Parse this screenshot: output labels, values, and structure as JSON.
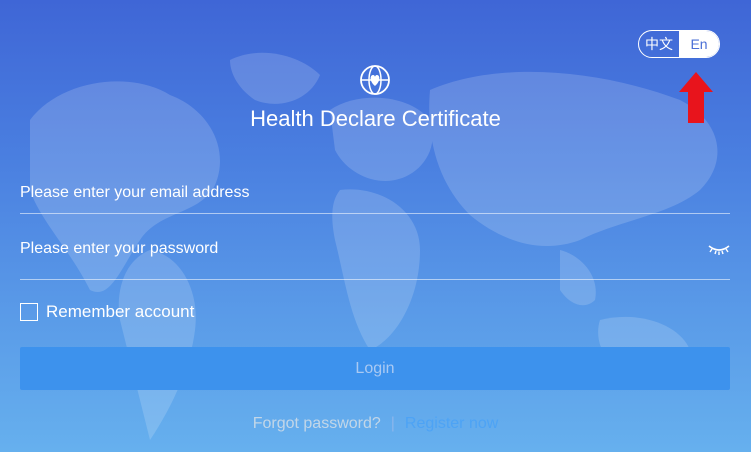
{
  "language_toggle": {
    "zh_label": "中文",
    "en_label": "En",
    "selected": "En"
  },
  "app": {
    "title": "Health Declare Certificate",
    "logo_icon": "globe-heart-icon"
  },
  "form": {
    "email_placeholder": "Please enter your email address",
    "email_value": "",
    "password_placeholder": "Please enter your password",
    "password_value": "",
    "password_toggle_icon": "eye-closed-icon",
    "remember_label": "Remember account",
    "remember_checked": false,
    "login_label": "Login"
  },
  "links": {
    "forgot": "Forgot password?",
    "separator": "|",
    "register": "Register now"
  },
  "annotation": {
    "arrow_icon": "red-up-arrow-icon",
    "arrow_color": "#e8141c"
  },
  "colors": {
    "background_top": "#3f66d6",
    "background_bottom": "#66b0ee",
    "button": "#3d92ed",
    "register_link": "#4da3f5"
  }
}
